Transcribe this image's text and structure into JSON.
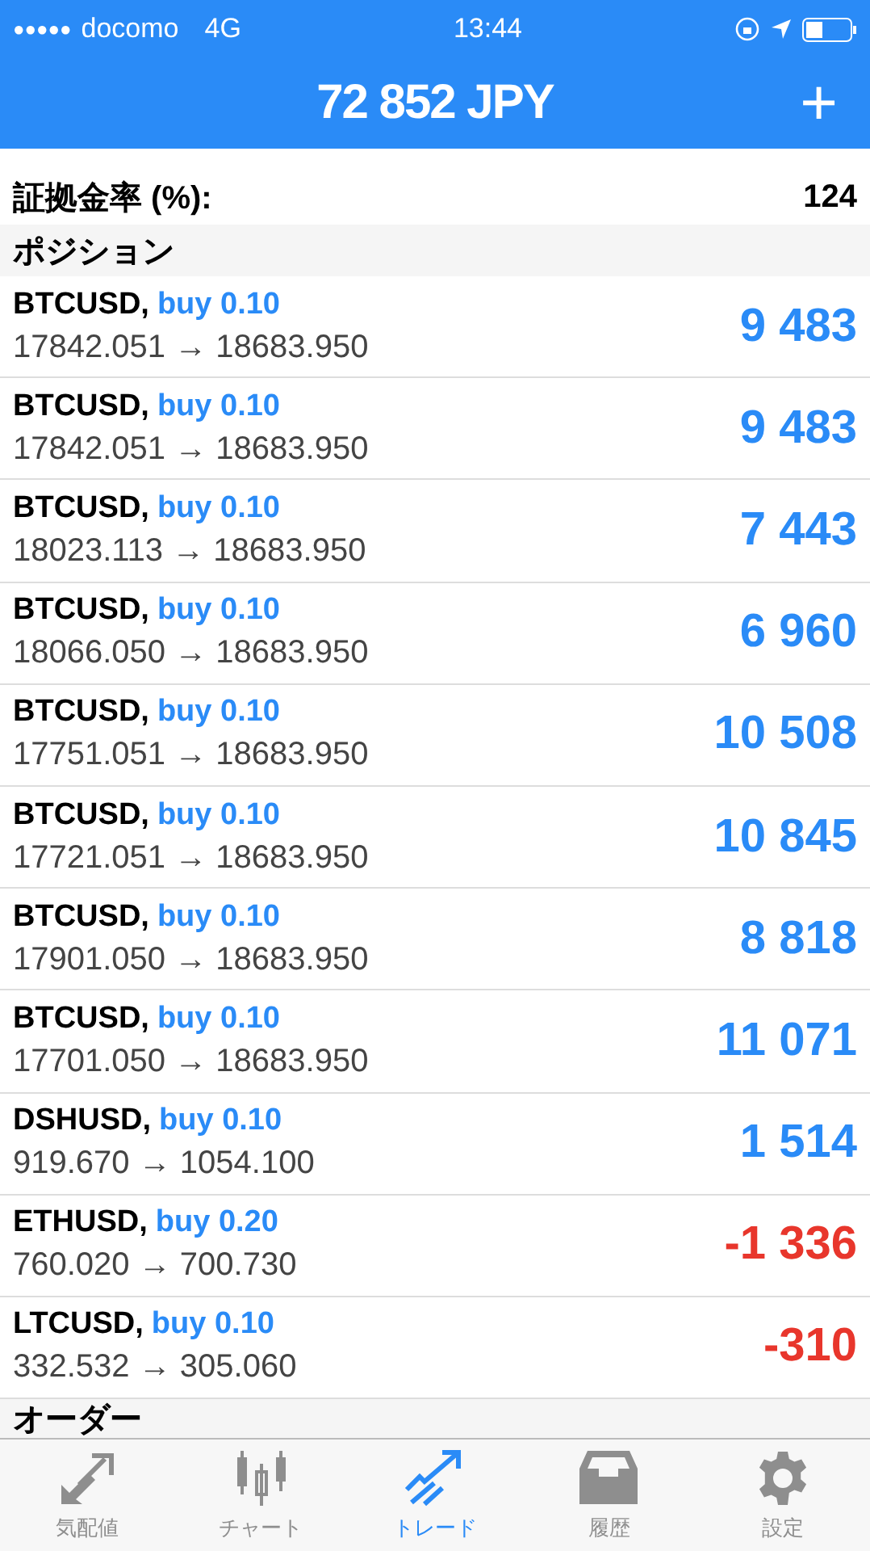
{
  "status_bar": {
    "signal_dots": "●●●●●",
    "carrier": "docomo",
    "network": "4G",
    "time": "13:44"
  },
  "header": {
    "title": "72 852 JPY",
    "add_button": "+"
  },
  "summary": [
    {
      "label": "証拠金率 (%):",
      "value": "124"
    }
  ],
  "positions": {
    "title": "ポジション",
    "rows": [
      {
        "symbol": "BTCUSD,",
        "side": "buy 0.10",
        "prices": "17842.051 → 18683.950",
        "profit": "9 483",
        "kind": "gain"
      },
      {
        "symbol": "BTCUSD,",
        "side": "buy 0.10",
        "prices": "17842.051 → 18683.950",
        "profit": "9 483",
        "kind": "gain"
      },
      {
        "symbol": "BTCUSD,",
        "side": "buy 0.10",
        "prices": "18023.113 → 18683.950",
        "profit": "7 443",
        "kind": "gain"
      },
      {
        "symbol": "BTCUSD,",
        "side": "buy 0.10",
        "prices": "18066.050 → 18683.950",
        "profit": "6 960",
        "kind": "gain"
      },
      {
        "symbol": "BTCUSD,",
        "side": "buy 0.10",
        "prices": "17751.051 → 18683.950",
        "profit": "10 508",
        "kind": "gain"
      },
      {
        "symbol": "BTCUSD,",
        "side": "buy 0.10",
        "prices": "17721.051 → 18683.950",
        "profit": "10 845",
        "kind": "gain"
      },
      {
        "symbol": "BTCUSD,",
        "side": "buy 0.10",
        "prices": "17901.050 → 18683.950",
        "profit": "8 818",
        "kind": "gain"
      },
      {
        "symbol": "BTCUSD,",
        "side": "buy 0.10",
        "prices": "17701.050 → 18683.950",
        "profit": "11 071",
        "kind": "gain"
      },
      {
        "symbol": "DSHUSD,",
        "side": "buy 0.10",
        "prices": "919.670 → 1054.100",
        "profit": "1 514",
        "kind": "gain"
      },
      {
        "symbol": "ETHUSD,",
        "side": "buy 0.20",
        "prices": "760.020 → 700.730",
        "profit": "-1 336",
        "kind": "loss"
      },
      {
        "symbol": "LTCUSD,",
        "side": "buy 0.10",
        "prices": "332.532 → 305.060",
        "profit": "-310",
        "kind": "loss"
      }
    ]
  },
  "orders": {
    "title": "オーダー"
  },
  "tab_bar": [
    {
      "label": "気配値",
      "kind": "quotes",
      "selected": false
    },
    {
      "label": "チャート",
      "kind": "chart",
      "selected": false
    },
    {
      "label": "トレード",
      "kind": "trade",
      "selected": true
    },
    {
      "label": "履歴",
      "kind": "history",
      "selected": false
    },
    {
      "label": "設定",
      "kind": "settings",
      "selected": false
    }
  ]
}
